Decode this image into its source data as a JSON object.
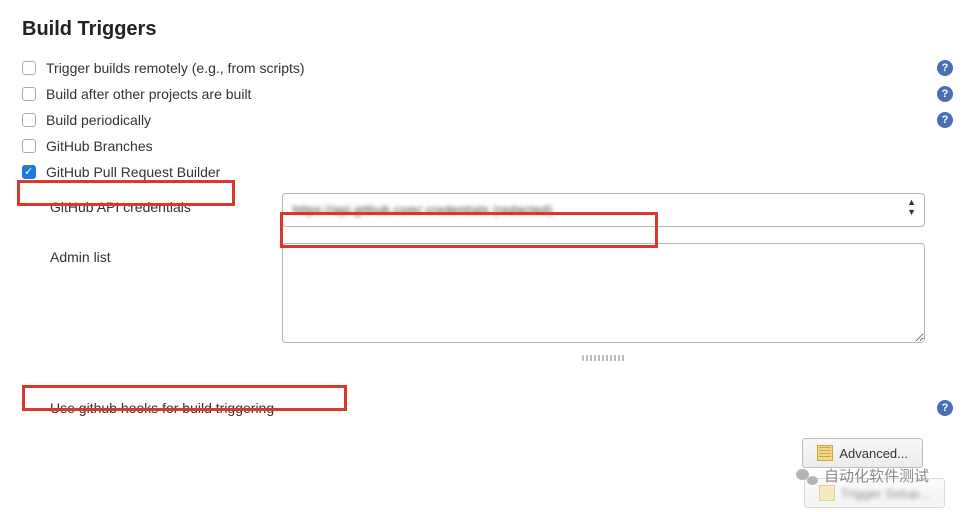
{
  "section_title": "Build Triggers",
  "triggers": {
    "remote": {
      "label": "Trigger builds remotely (e.g., from scripts)",
      "checked": false,
      "help": true
    },
    "after_other": {
      "label": "Build after other projects are built",
      "checked": false,
      "help": true
    },
    "periodic": {
      "label": "Build periodically",
      "checked": false,
      "help": true
    },
    "gh_branches": {
      "label": "GitHub Branches",
      "checked": false,
      "help": false
    },
    "gh_pr_builder": {
      "label": "GitHub Pull Request Builder",
      "checked": true,
      "help": false
    }
  },
  "pr_builder": {
    "api_credentials_label": "GitHub API credentials",
    "api_credentials_value": "https://api.github.com/ credentials (redacted)",
    "admin_list_label": "Admin list",
    "admin_list_value": ""
  },
  "hooks": {
    "label": "Use github hooks for build triggering",
    "checked": true,
    "help": true
  },
  "buttons": {
    "advanced": "Advanced...",
    "second_obscured": "Trigger Setup..."
  },
  "watermark": "自动化软件测试",
  "icons": {
    "help": "?"
  }
}
